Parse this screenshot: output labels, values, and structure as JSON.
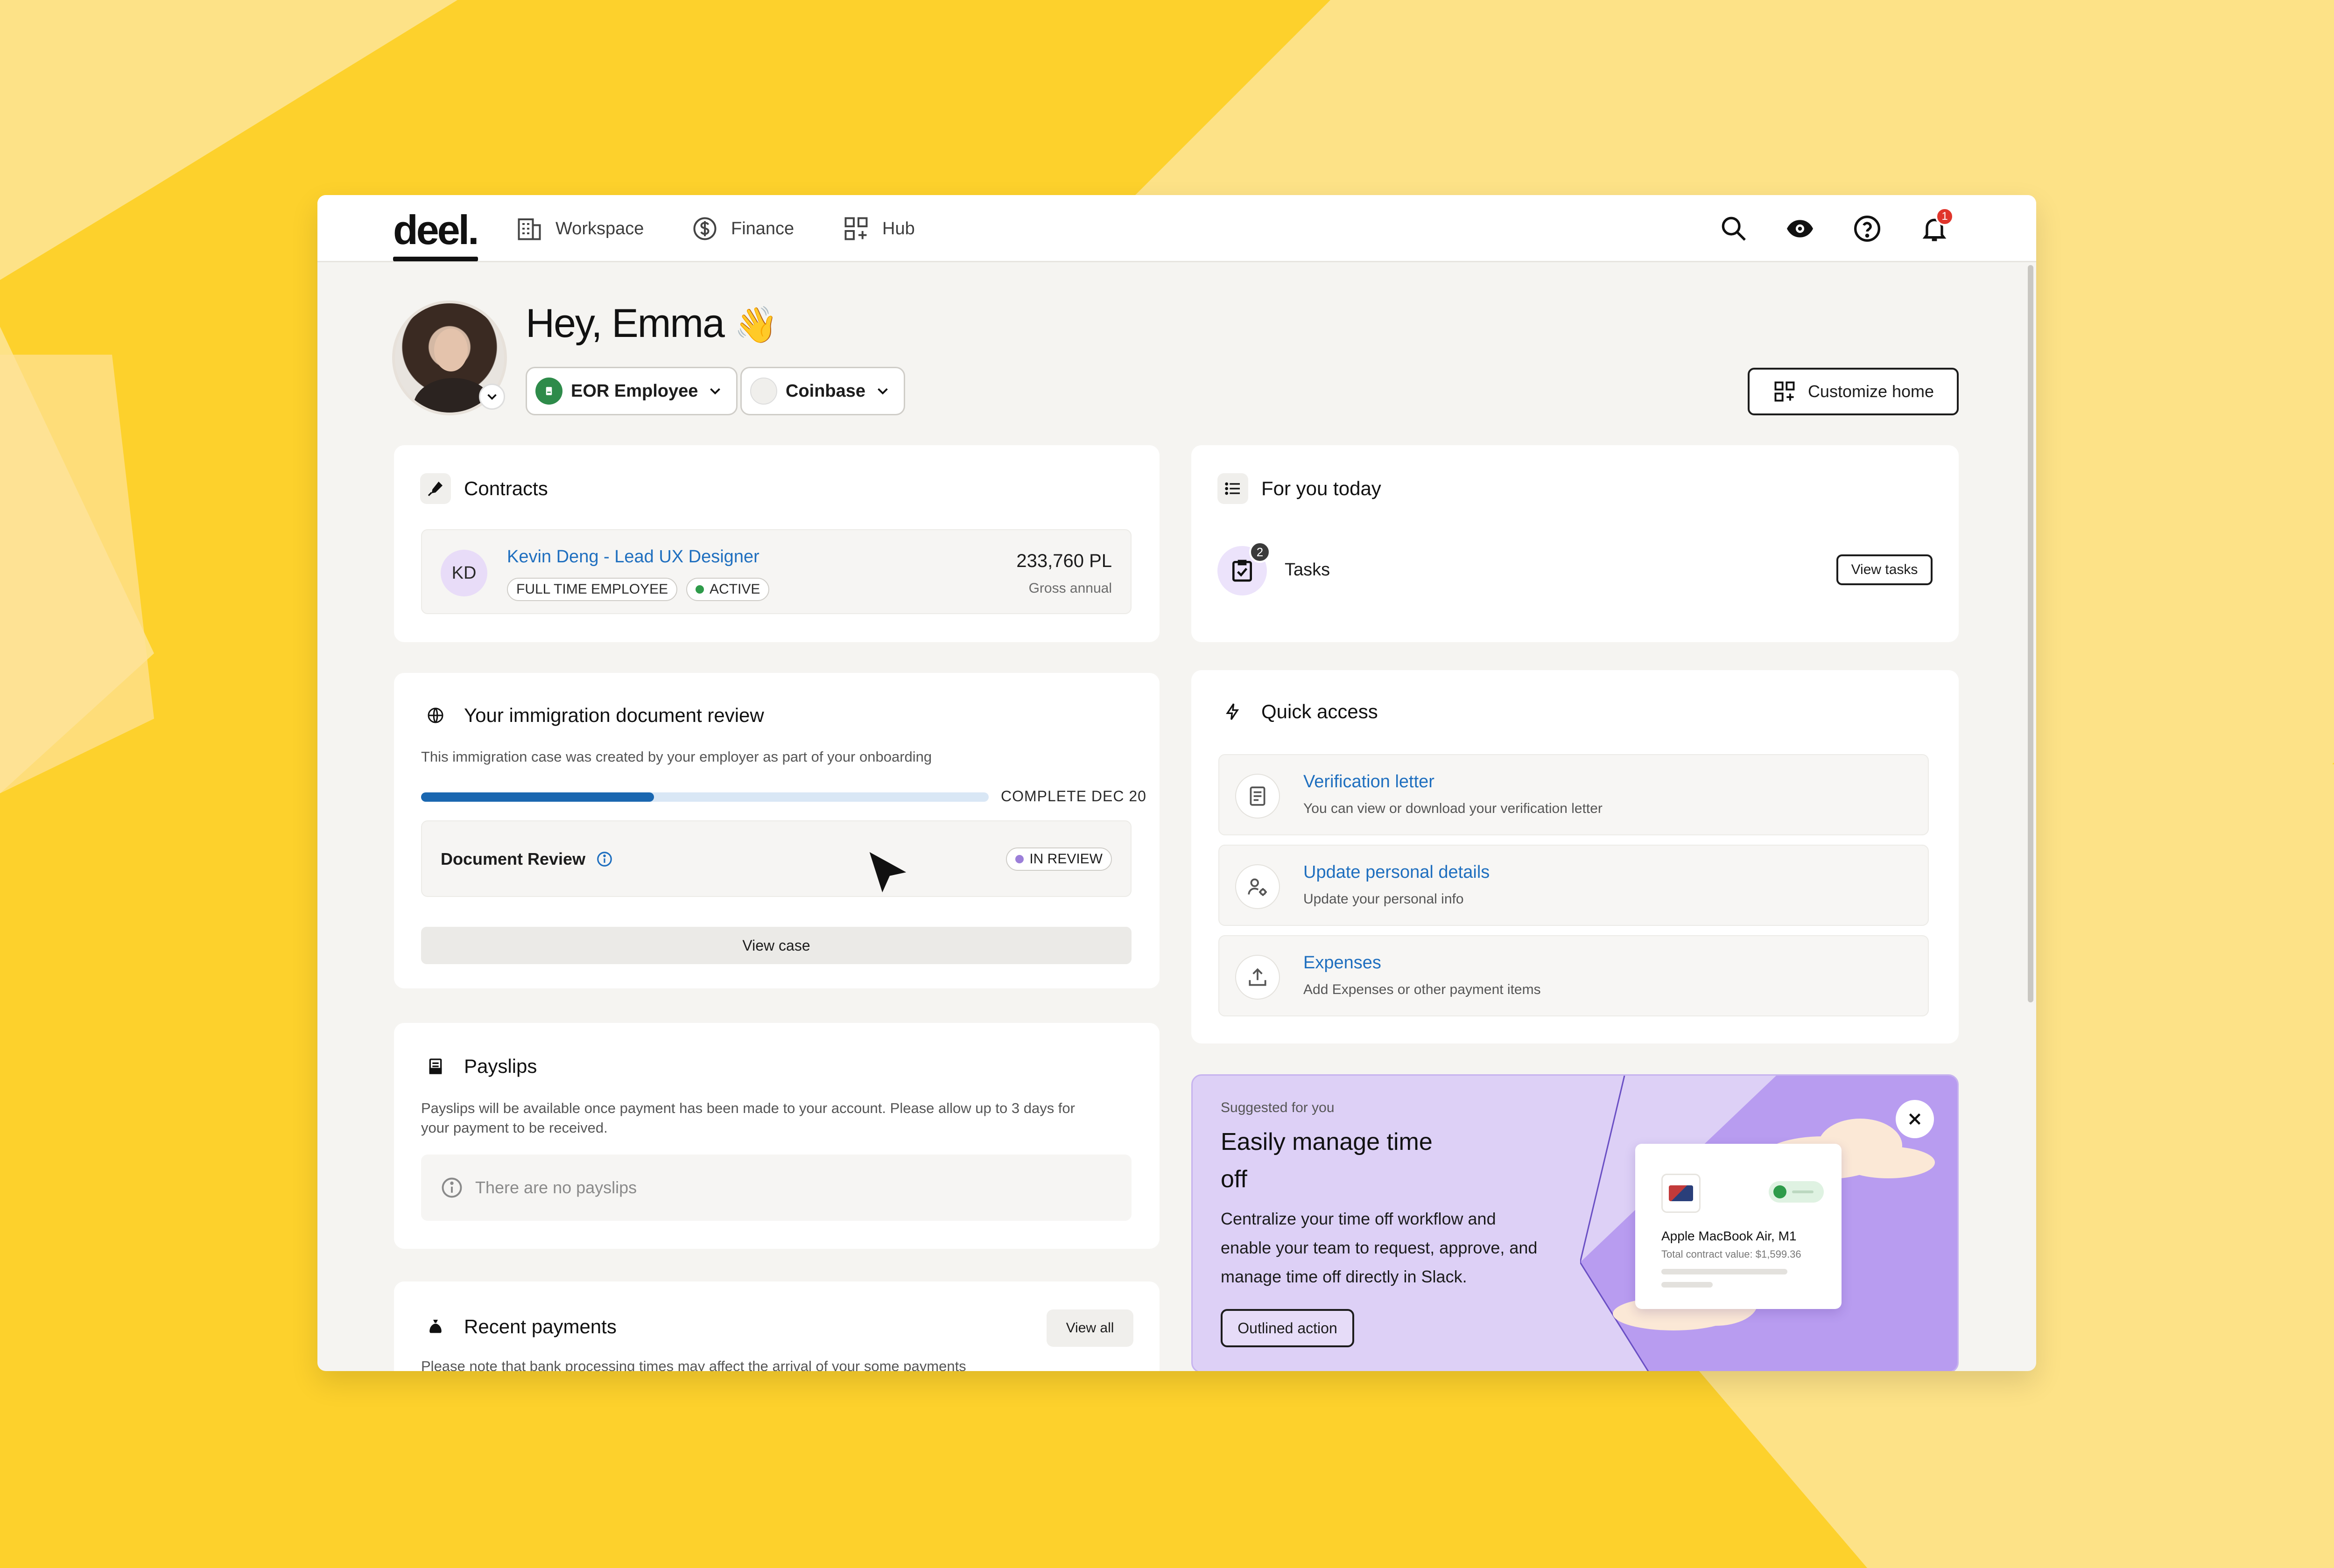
{
  "theme": {
    "background": "#fdd12c",
    "accent": "#1f6fbf",
    "progress": "#1a67b0",
    "suggest_bg": "#ddd0f6"
  },
  "nav": {
    "logo": "deel.",
    "items": [
      {
        "label": "Workspace",
        "icon": "building-icon"
      },
      {
        "label": "Finance",
        "icon": "dollar-circle-icon"
      },
      {
        "label": "Hub",
        "icon": "grid-plus-icon"
      }
    ],
    "actions": [
      "search-icon",
      "eye-icon",
      "help-circle-icon",
      "bell-icon"
    ],
    "notification_count": "1"
  },
  "header": {
    "greeting": "Hey, Emma",
    "wave": "👋",
    "role_pill": "EOR Employee",
    "company_pill": "Coinbase",
    "customize_label": "Customize home"
  },
  "contracts": {
    "title": "Contracts",
    "initials": "KD",
    "name": "Kevin Deng - Lead UX Designer",
    "type_tag": "FULL TIME EMPLOYEE",
    "status_tag": "ACTIVE",
    "amount": "233,760 PL",
    "amount_label": "Gross annual"
  },
  "immigration": {
    "title": "Your immigration document review",
    "subtitle": "This immigration case was created by your employer as part of your onboarding",
    "progress": 0.41,
    "progress_label": "COMPLETE DEC 20",
    "doc_title": "Document Review",
    "doc_status": "IN REVIEW",
    "button": "View case"
  },
  "payslips": {
    "title": "Payslips",
    "subtitle": "Payslips will be available once payment has been made to your account. Please allow up to 3 days for your payment to be received.",
    "empty": "There are no payslips"
  },
  "recent_payments": {
    "title": "Recent payments",
    "view_all": "View all",
    "subtitle": "Please note that bank processing times may affect the arrival of your some payments"
  },
  "for_you_today": {
    "title": "For you today",
    "task_label": "Tasks",
    "task_count": "2",
    "button": "View tasks"
  },
  "quick_access": {
    "title": "Quick access",
    "items": [
      {
        "title": "Verification letter",
        "subtitle": "You can view or download your verification letter",
        "icon": "document-icon"
      },
      {
        "title": "Update personal details",
        "subtitle": "Update your personal info",
        "icon": "user-settings-icon"
      },
      {
        "title": "Expenses",
        "subtitle": "Add Expenses or other payment items",
        "icon": "upload-icon"
      }
    ]
  },
  "suggested": {
    "kicker": "Suggested for you",
    "title": "Easily manage time off",
    "body": "Centralize your time off workflow and enable your team to request, approve, and manage time off directly in Slack.",
    "button": "Outlined action",
    "preview_name": "Apple MacBook Air, M1",
    "preview_sub": "Total contract value: $1,599.36"
  }
}
